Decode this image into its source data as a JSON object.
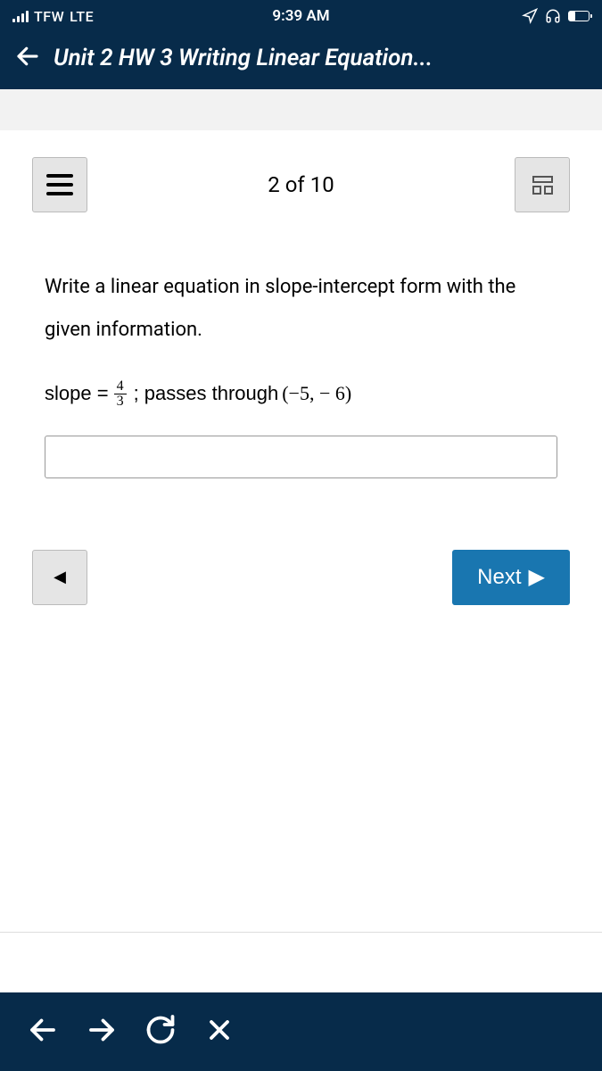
{
  "status": {
    "carrier": "TFW",
    "network": "LTE",
    "time": "9:39 AM"
  },
  "header": {
    "title": "Unit 2 HW 3 Writing Linear Equation..."
  },
  "question": {
    "counter": "2 of 10",
    "prompt": "Write a linear equation in slope-intercept form with the given information.",
    "slope_label": "slope = ",
    "fraction_num": "4",
    "fraction_den": "3",
    "passes_label": "; passes through ",
    "point": "(−5,  − 6)",
    "answer_value": ""
  },
  "nav": {
    "next_label": "Next",
    "prev_glyph": "◀",
    "next_glyph": "▶"
  }
}
